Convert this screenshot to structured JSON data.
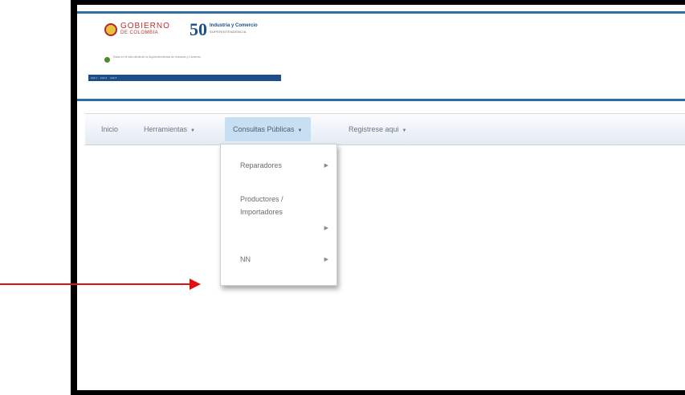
{
  "header": {
    "gov_logo_line1": "GOBIERNO",
    "gov_logo_line2": "DE COLOMBIA",
    "anniversary_number": "50",
    "anniversary_line1": "Industria y Comercio",
    "anniversary_line2": "SUPERINTENDENCIA",
    "blurb": "Estas en el sitio oficial de la Superintendencia de Industria y Comercio",
    "blue_bar_links": [
      "Link 1",
      "Link 2",
      "Link 3"
    ]
  },
  "nav": {
    "items": [
      {
        "label": "Inicio"
      },
      {
        "label": "Herramientas",
        "caret": "▼"
      },
      {
        "label": "Consultas Públicas",
        "caret": "▼"
      },
      {
        "label": "Registrese aqui",
        "caret": "▼"
      }
    ]
  },
  "dropdown": {
    "items": [
      {
        "label": "Reparadores",
        "arrow": "▶"
      },
      {
        "label": "Productores / Importadores",
        "arrow": "▶"
      },
      {
        "label": "NN",
        "arrow": "▶"
      }
    ]
  },
  "colors": {
    "accent_rule": "#2f6fa5",
    "nav_active_bg": "#c6dff2",
    "annotation_arrow": "#e01010"
  }
}
